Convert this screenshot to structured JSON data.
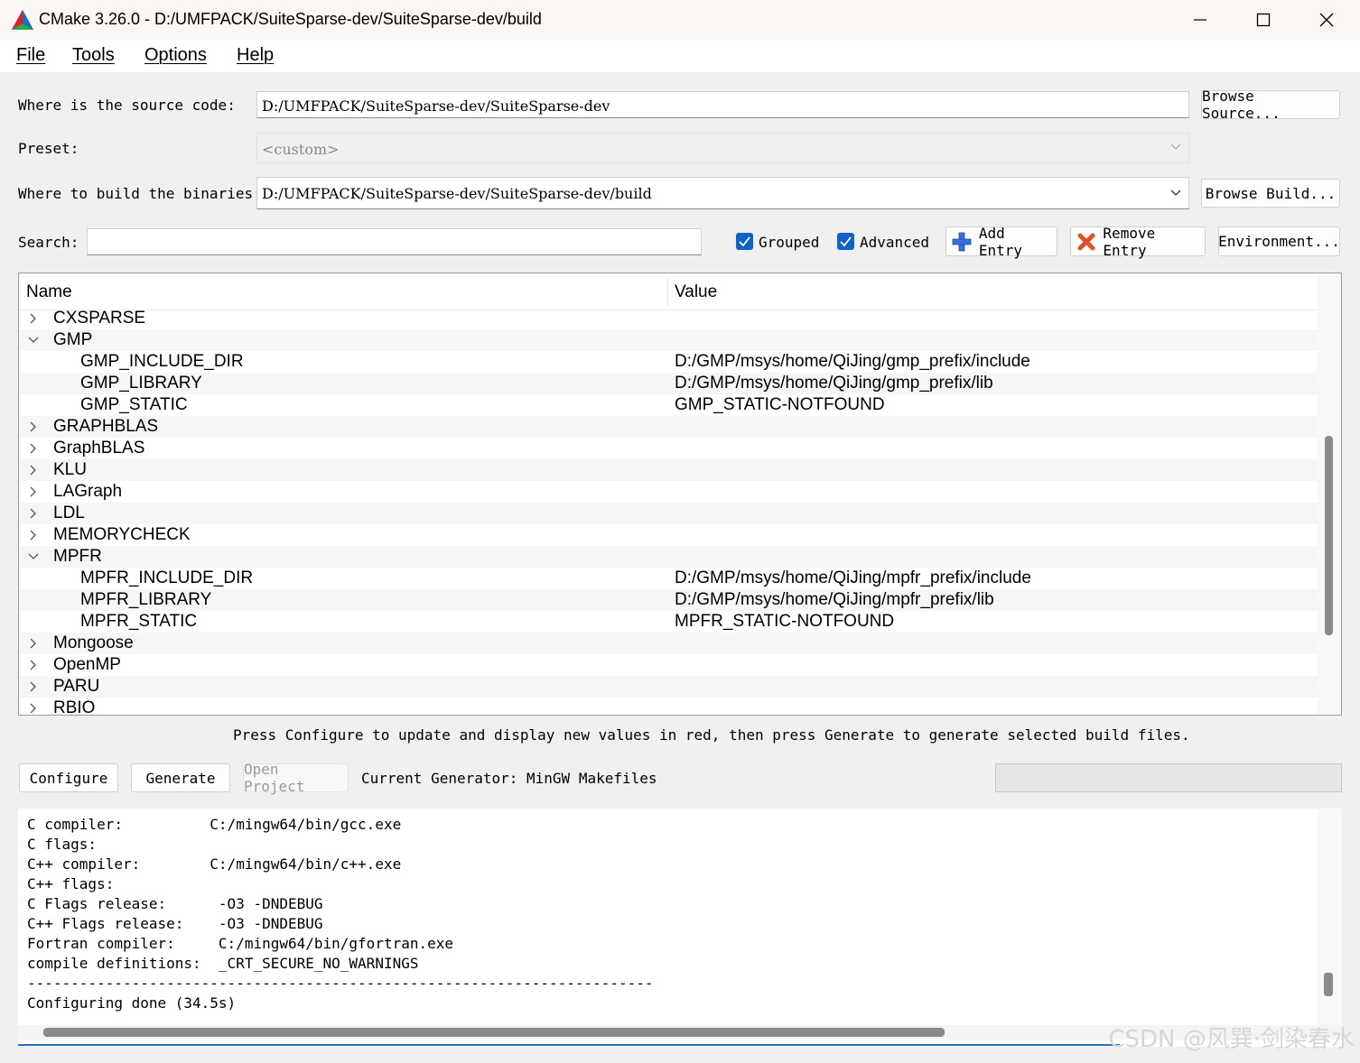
{
  "window": {
    "title": "CMake 3.26.0 - D:/UMFPACK/SuiteSparse-dev/SuiteSparse-dev/build",
    "logo_icon": "cmake-triangle-icon",
    "controls": [
      "minimize-icon",
      "maximize-icon",
      "close-icon"
    ]
  },
  "menu": [
    "File",
    "Tools",
    "Options",
    "Help"
  ],
  "source": {
    "label": "Where is the source code:",
    "value": "D:/UMFPACK/SuiteSparse-dev/SuiteSparse-dev",
    "browse_label": "Browse Source..."
  },
  "preset": {
    "label": "Preset:",
    "value": "<custom>"
  },
  "build": {
    "label": "Where to build the binaries:",
    "value": "D:/UMFPACK/SuiteSparse-dev/SuiteSparse-dev/build",
    "browse_label": "Browse Build..."
  },
  "search": {
    "label": "Search:",
    "value": ""
  },
  "toolbar": {
    "grouped_label": "Grouped",
    "grouped_checked": true,
    "advanced_label": "Advanced",
    "advanced_checked": true,
    "add_entry_label": "Add Entry",
    "remove_entry_label": "Remove Entry",
    "environment_label": "Environment..."
  },
  "tree": {
    "headers": {
      "name": "Name",
      "value": "Value"
    },
    "rows": [
      {
        "name": "CXSPARSE",
        "value": "",
        "expanded": false
      },
      {
        "name": "GMP",
        "value": "",
        "expanded": true
      },
      {
        "name": "GMP_INCLUDE_DIR",
        "value": "D:/GMP/msys/home/QiJing/gmp_prefix/include",
        "child": true
      },
      {
        "name": "GMP_LIBRARY",
        "value": "D:/GMP/msys/home/QiJing/gmp_prefix/lib",
        "child": true
      },
      {
        "name": "GMP_STATIC",
        "value": "GMP_STATIC-NOTFOUND",
        "child": true
      },
      {
        "name": "GRAPHBLAS",
        "value": "",
        "expanded": false
      },
      {
        "name": "GraphBLAS",
        "value": "",
        "expanded": false
      },
      {
        "name": "KLU",
        "value": "",
        "expanded": false
      },
      {
        "name": "LAGraph",
        "value": "",
        "expanded": false
      },
      {
        "name": "LDL",
        "value": "",
        "expanded": false
      },
      {
        "name": "MEMORYCHECK",
        "value": "",
        "expanded": false
      },
      {
        "name": "MPFR",
        "value": "",
        "expanded": true
      },
      {
        "name": "MPFR_INCLUDE_DIR",
        "value": "D:/GMP/msys/home/QiJing/mpfr_prefix/include",
        "child": true
      },
      {
        "name": "MPFR_LIBRARY",
        "value": "D:/GMP/msys/home/QiJing/mpfr_prefix/lib",
        "child": true
      },
      {
        "name": "MPFR_STATIC",
        "value": "MPFR_STATIC-NOTFOUND",
        "child": true
      },
      {
        "name": "Mongoose",
        "value": "",
        "expanded": false
      },
      {
        "name": "OpenMP",
        "value": "",
        "expanded": false
      },
      {
        "name": "PARU",
        "value": "",
        "expanded": false
      },
      {
        "name": "RBIO",
        "value": "",
        "expanded": false
      }
    ]
  },
  "hint": "Press Configure to update and display new values in red, then press Generate to generate selected build files.",
  "actions": {
    "configure_label": "Configure",
    "generate_label": "Generate",
    "open_project_label": "Open Project",
    "generator_text": "Current Generator: MinGW Makefiles"
  },
  "log": [
    "C compiler:          C:/mingw64/bin/gcc.exe",
    "C flags:",
    "C++ compiler:        C:/mingw64/bin/c++.exe",
    "C++ flags:",
    "C Flags release:      -O3 -DNDEBUG",
    "C++ Flags release:    -O3 -DNDEBUG",
    "Fortran compiler:     C:/mingw64/bin/gfortran.exe",
    "compile definitions:  _CRT_SECURE_NO_WARNINGS",
    "------------------------------------------------------------------------",
    "Configuring done (34.5s)"
  ],
  "watermark": "CSDN @风巽·剑染春水"
}
